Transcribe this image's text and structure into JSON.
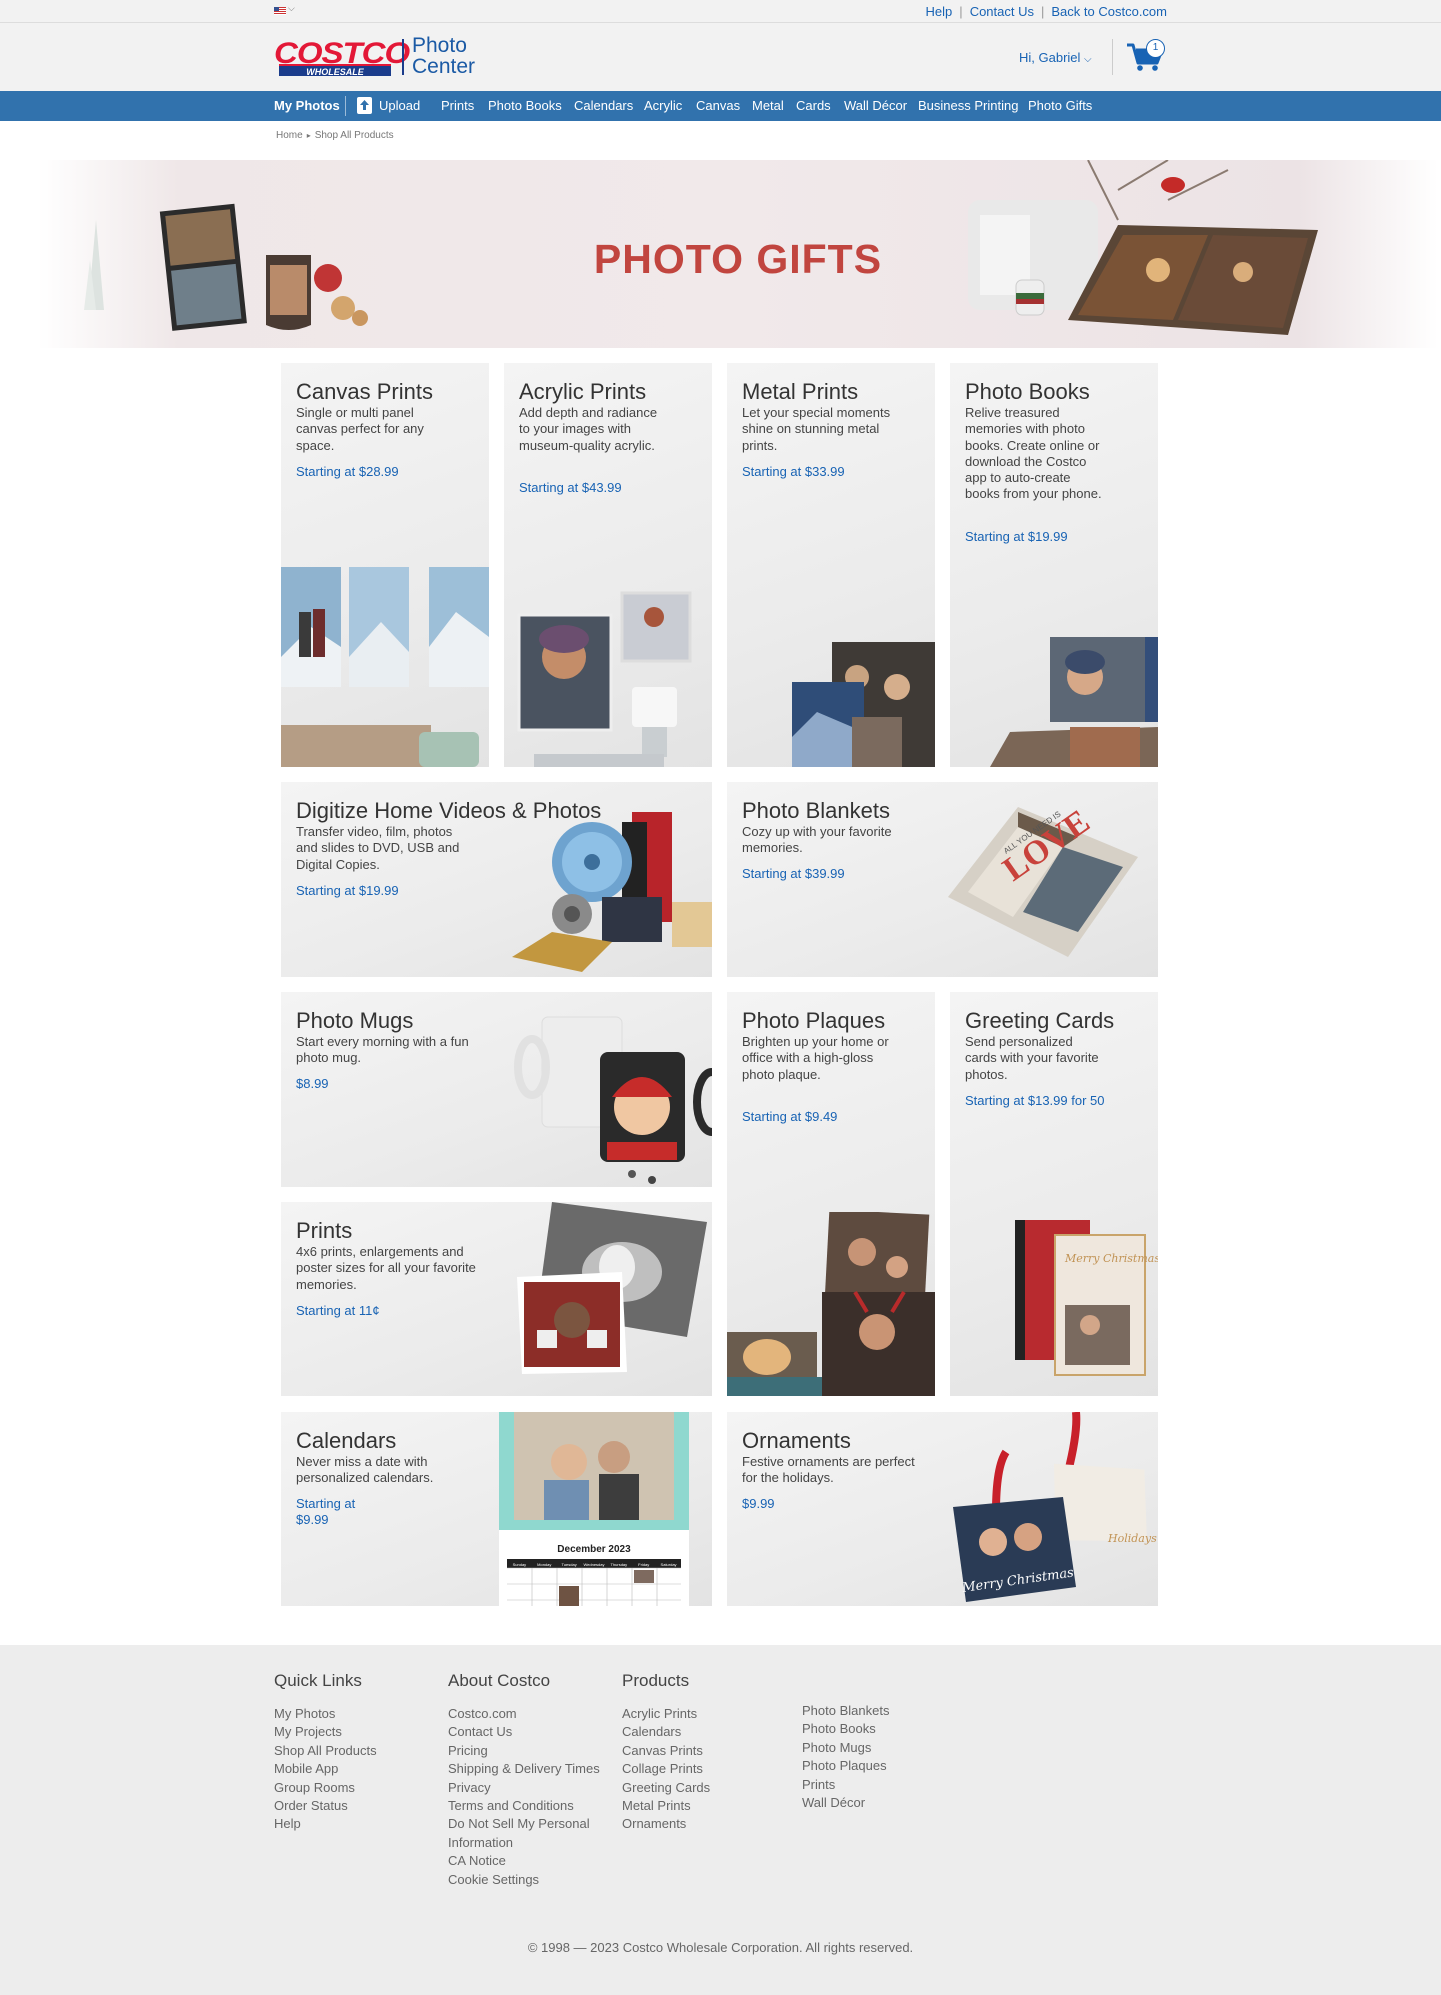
{
  "topbar": {
    "links": [
      "Help",
      "Contact Us",
      "Back to Costco.com"
    ]
  },
  "header": {
    "logo_costco": "COSTCO",
    "logo_wholesale": "WHOLESALE",
    "logo_photo": "Photo",
    "logo_center": "Center",
    "greeting": "Hi, Gabriel",
    "cart_count": "1"
  },
  "nav": {
    "my_photos": "My Photos",
    "upload": "Upload",
    "items": [
      "Prints",
      "Photo Books",
      "Calendars",
      "Acrylic",
      "Canvas",
      "Metal",
      "Cards",
      "Wall Décor",
      "Business Printing",
      "Photo Gifts"
    ]
  },
  "breadcrumb": {
    "home": "Home",
    "current": "Shop All Products"
  },
  "hero": {
    "title": "PHOTO GIFTS"
  },
  "tiles": [
    {
      "title": "Canvas Prints",
      "desc": "Single or multi panel canvas perfect for any space.",
      "price": "Starting at $28.99"
    },
    {
      "title": "Acrylic Prints",
      "desc": "Add depth and radiance to your images with museum-quality acrylic.",
      "price": "Starting at $43.99"
    },
    {
      "title": "Metal Prints",
      "desc": "Let your special moments shine on stunning metal prints.",
      "price": "Starting at $33.99"
    },
    {
      "title": "Photo Books",
      "desc": "Relive treasured memories with photo books. Create online or download the Costco app to auto-create books from your phone.",
      "price": "Starting at $19.99"
    },
    {
      "title": "Digitize Home Videos & Photos",
      "desc": "Transfer video, film, photos and slides to DVD, USB and Digital Copies.",
      "price": "Starting at $19.99"
    },
    {
      "title": "Photo Blankets",
      "desc": "Cozy up with your favorite memories.",
      "price": "Starting at $39.99"
    },
    {
      "title": "Photo Mugs",
      "desc": "Start every morning with a fun photo mug.",
      "price": "$8.99"
    },
    {
      "title": "Photo Plaques",
      "desc": "Brighten up your home or office with a high-gloss photo plaque.",
      "price": "Starting at $9.49"
    },
    {
      "title": "Greeting Cards",
      "desc": "Send personalized cards with your favorite photos.",
      "price": "Starting at $13.99 for 50"
    },
    {
      "title": "Prints",
      "desc": "4x6 prints, enlargements and poster sizes for all your favorite memories.",
      "price": "Starting at 11¢"
    },
    {
      "title": "Calendars",
      "desc": "Never miss a date with personalized calendars.",
      "price": "Starting at $9.99"
    },
    {
      "title": "Ornaments",
      "desc": "Festive ornaments are perfect for the holidays.",
      "price": "$9.99"
    }
  ],
  "product_image_text": {
    "blanket_word": "LOVE",
    "blanket_phrase": "ALL YOU NEED IS",
    "calendar_month": "December 2023",
    "calendar_days": [
      "Sunday",
      "Monday",
      "Tuesday",
      "Wednesday",
      "Thursday",
      "Friday",
      "Saturday"
    ],
    "card_text": "Merry Christmas",
    "ornament_text_1": "Merry Christmas",
    "ornament_text_2": "Holidays"
  },
  "footer": {
    "quick_links": {
      "title": "Quick Links",
      "items": [
        "My Photos",
        "My Projects",
        "Shop All Products",
        "Mobile App",
        "Group Rooms",
        "Order Status",
        "Help"
      ]
    },
    "about": {
      "title": "About Costco",
      "items": [
        "Costco.com",
        "Contact Us",
        "Pricing",
        "Shipping & Delivery Times",
        "Privacy",
        "Terms and Conditions",
        "Do Not Sell My Personal Information",
        "CA Notice",
        "Cookie Settings"
      ]
    },
    "products": {
      "title": "Products",
      "col1": [
        "Acrylic Prints",
        "Calendars",
        "Canvas Prints",
        "Collage Prints",
        "Greeting Cards",
        "Metal Prints",
        "Ornaments"
      ],
      "col2": [
        "Photo Blankets",
        "Photo Books",
        "Photo Mugs",
        "Photo Plaques",
        "Prints",
        "Wall Décor"
      ]
    },
    "copyright": "© 1998 — 2023 Costco Wholesale Corporation. All rights reserved."
  },
  "colors": {
    "nav_blue": "#3172ad",
    "link_blue": "#1863b4",
    "costco_red": "#e31837",
    "costco_navy": "#1b3c8b",
    "hero_title": "#c1453f"
  }
}
